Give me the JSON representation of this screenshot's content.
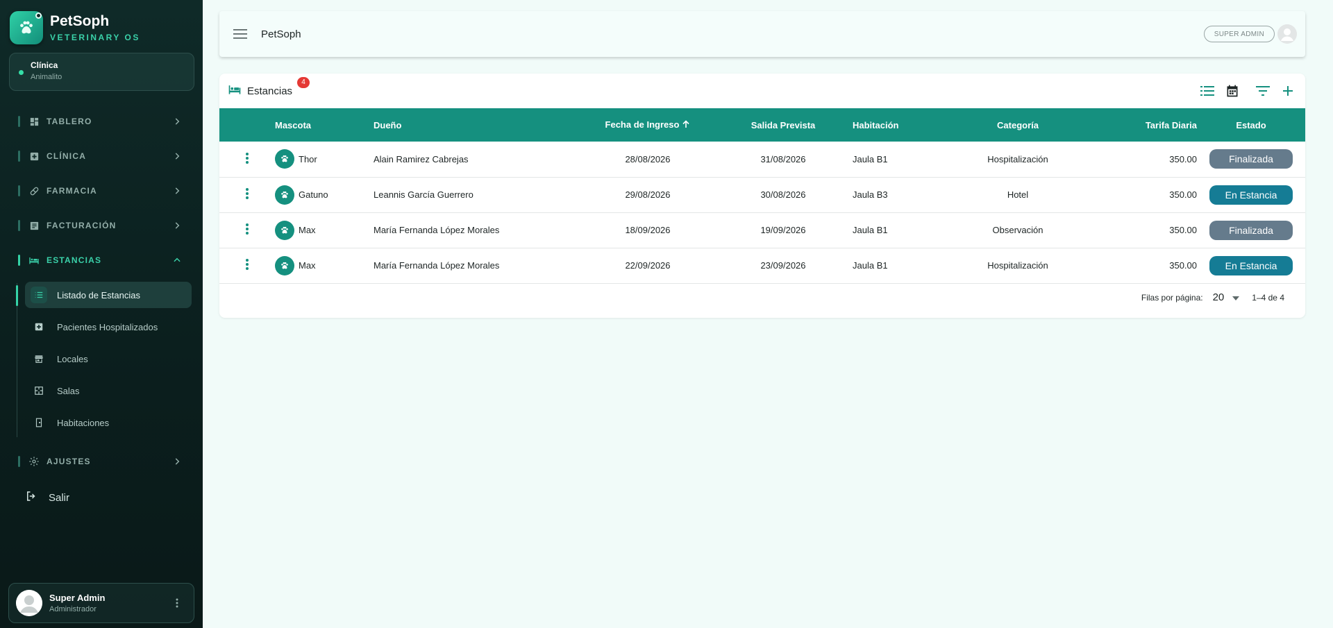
{
  "brand": {
    "name": "PetSoph",
    "subtitle": "VETERINARY OS"
  },
  "clinic": {
    "label": "Clínica",
    "value": "Animalito"
  },
  "nav": {
    "items": [
      {
        "label": "TABLERO",
        "icon": "dashboard-icon"
      },
      {
        "label": "CLÍNICA",
        "icon": "medical-plus-icon"
      },
      {
        "label": "FARMACIA",
        "icon": "pill-icon"
      },
      {
        "label": "FACTURACIÓN",
        "icon": "invoice-icon"
      },
      {
        "label": "ESTANCIAS",
        "icon": "bed-icon",
        "active": true
      },
      {
        "label": "AJUSTES",
        "icon": "gear-icon"
      }
    ],
    "sub_items": [
      {
        "label": "Listado de Estancias",
        "icon": "list-icon",
        "active": true
      },
      {
        "label": "Pacientes Hospitalizados",
        "icon": "medical-plus-icon"
      },
      {
        "label": "Locales",
        "icon": "store-icon"
      },
      {
        "label": "Salas",
        "icon": "floor-plan-icon"
      },
      {
        "label": "Habitaciones",
        "icon": "door-icon"
      }
    ],
    "logout_label": "Salir"
  },
  "user": {
    "name": "Super Admin",
    "role": "Administrador"
  },
  "topbar": {
    "title": "PetSoph",
    "role_chip": "SUPER ADMIN"
  },
  "card": {
    "title": "Estancias",
    "count": "4"
  },
  "table": {
    "headers": {
      "pet": "Mascota",
      "owner": "Dueño",
      "check_in": "Fecha de Ingreso",
      "check_out": "Salida Prevista",
      "room": "Habitación",
      "category": "Categoría",
      "rate": "Tarifa Diaria",
      "status": "Estado"
    },
    "rows": [
      {
        "pet": "Thor",
        "owner": "Alain Ramirez Cabrejas",
        "check_in": "28/08/2026",
        "check_out": "31/08/2026",
        "room": "Jaula B1",
        "category": "Hospitalización",
        "rate": "350.00",
        "status": "Finalizada"
      },
      {
        "pet": "Gatuno",
        "owner": "Leannis García Guerrero",
        "check_in": "29/08/2026",
        "check_out": "30/08/2026",
        "room": "Jaula B3",
        "category": "Hotel",
        "rate": "350.00",
        "status": "En Estancia"
      },
      {
        "pet": "Max",
        "owner": "María Fernanda López Morales",
        "check_in": "18/09/2026",
        "check_out": "19/09/2026",
        "room": "Jaula B1",
        "category": "Observación",
        "rate": "350.00",
        "status": "Finalizada"
      },
      {
        "pet": "Max",
        "owner": "María Fernanda López Morales",
        "check_in": "22/09/2026",
        "check_out": "23/09/2026",
        "room": "Jaula B1",
        "category": "Hospitalización",
        "rate": "350.00",
        "status": "En Estancia"
      }
    ]
  },
  "pager": {
    "rows_label": "Filas por página:",
    "page_size": "20",
    "range": "1–4 de 4"
  },
  "colors": {
    "primary": "#15907f",
    "accent": "#3ad1a9",
    "finished": "#657b8c",
    "in_stay": "#157c95",
    "badge": "#e53935"
  }
}
